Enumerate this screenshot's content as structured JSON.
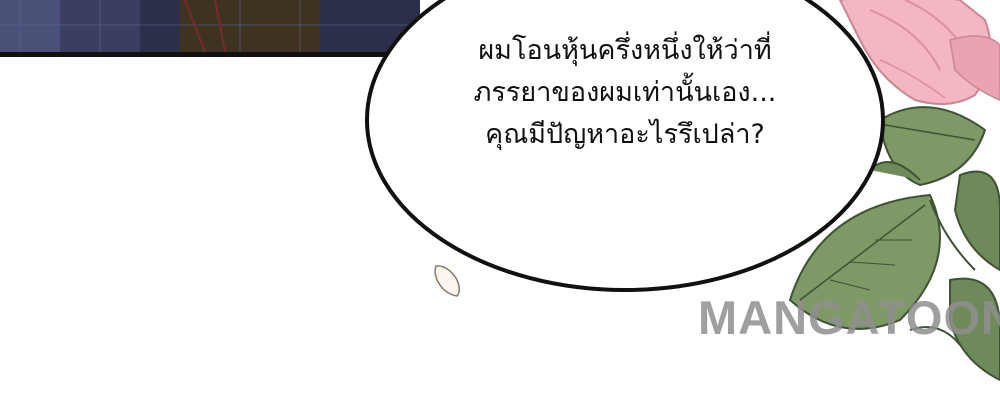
{
  "speech_bubble": {
    "lines": [
      "ผมโอนหุ้นครึ่งหนึ่งให้ว่าที่",
      "ภรรยาของผมเท่านั้นเอง...",
      "คุณมีปัญหาอะไรรึเปล่า?"
    ]
  },
  "watermark": {
    "text": "MANGATOON"
  },
  "colors": {
    "bubble_fill": "#ffffff",
    "bubble_outline": "#111111",
    "flower": "#f4b6c2",
    "leaf": "#6f8a5a",
    "dark_scene": "#2c2f4a",
    "watermark": "#8f8f8f"
  }
}
